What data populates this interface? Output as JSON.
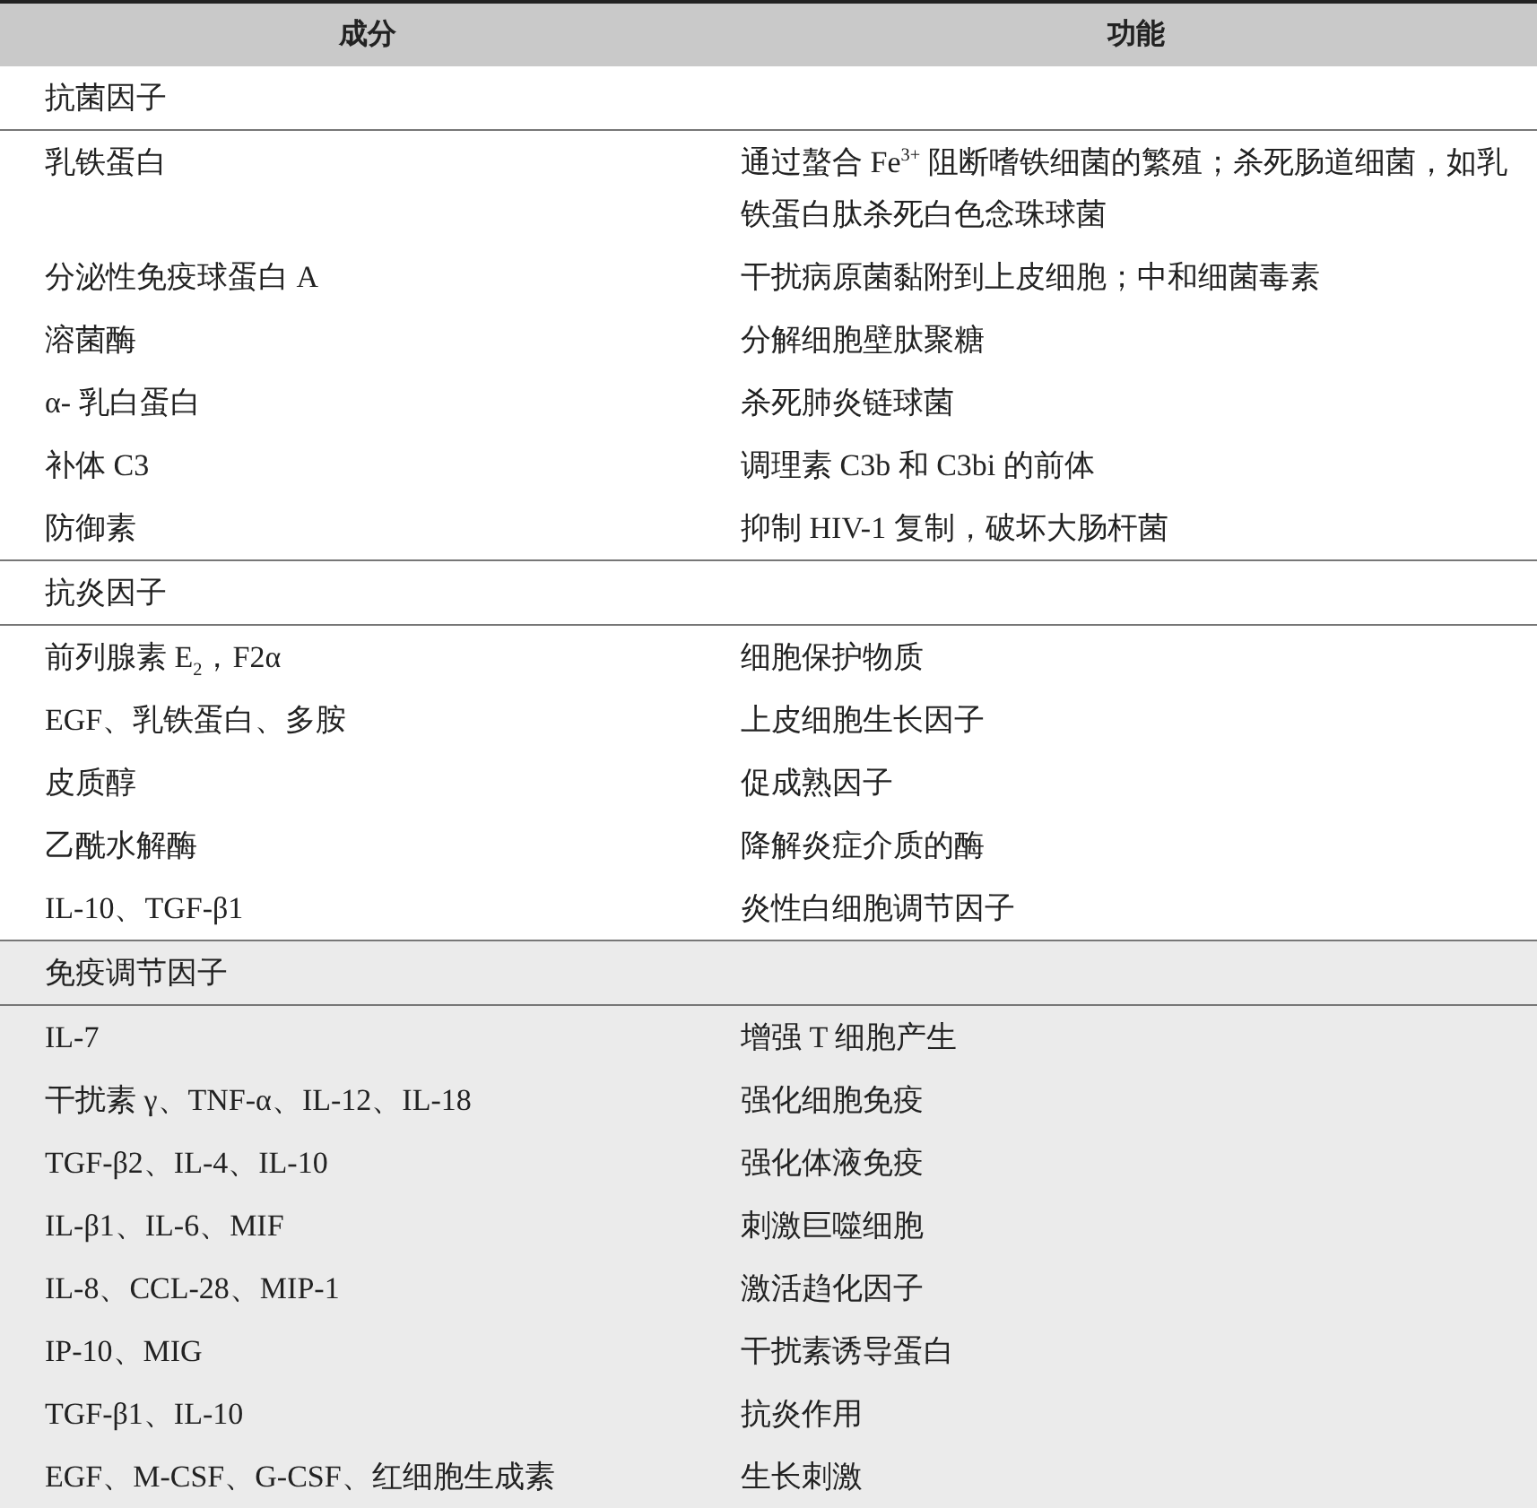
{
  "table": {
    "columns": [
      "成分",
      "功能"
    ],
    "groups": [
      {
        "title": "抗菌因子",
        "shaded": false,
        "rows": [
          {
            "component": "乳铁蛋白",
            "function": "通过螯合 Fe$^{3+}$ 阻断嗜铁细菌的繁殖；杀死肠道细菌，如乳铁蛋白肽杀死白色念珠球菌"
          },
          {
            "component": "分泌性免疫球蛋白 A",
            "function": "干扰病原菌黏附到上皮细胞；中和细菌毒素"
          },
          {
            "component": "溶菌酶",
            "function": "分解细胞壁肽聚糖"
          },
          {
            "component": "α- 乳白蛋白",
            "function": "杀死肺炎链球菌"
          },
          {
            "component": "补体 C3",
            "function": "调理素 C3b 和 C3bi 的前体"
          },
          {
            "component": "防御素",
            "function": "抑制 HIV-1 复制，破坏大肠杆菌"
          }
        ]
      },
      {
        "title": "抗炎因子",
        "shaded": false,
        "rows": [
          {
            "component": "前列腺素 E$_{2}$，F2α",
            "function": "细胞保护物质"
          },
          {
            "component": "EGF、乳铁蛋白、多胺",
            "function": "上皮细胞生长因子"
          },
          {
            "component": "皮质醇",
            "function": "促成熟因子"
          },
          {
            "component": "乙酰水解酶",
            "function": "降解炎症介质的酶"
          },
          {
            "component": "IL-10、TGF-β1",
            "function": "炎性白细胞调节因子"
          }
        ]
      },
      {
        "title": "免疫调节因子",
        "shaded": true,
        "rows": [
          {
            "component": "IL-7",
            "function": "增强 T 细胞产生"
          },
          {
            "component": "干扰素 γ、TNF-α、IL-12、IL-18",
            "function": "强化细胞免疫"
          },
          {
            "component": "TGF-β2、IL-4、IL-10",
            "function": "强化体液免疫"
          },
          {
            "component": "IL-β1、IL-6、MIF",
            "function": "刺激巨噬细胞"
          },
          {
            "component": "IL-8、CCL-28、MIP-1",
            "function": "激活趋化因子"
          },
          {
            "component": "IP-10、MIG",
            "function": "干扰素诱导蛋白"
          },
          {
            "component": "TGF-β1、IL-10",
            "function": "抗炎作用"
          },
          {
            "component": "EGF、M-CSF、G-CSF、红细胞生成素",
            "function": "生长刺激"
          }
        ]
      }
    ]
  }
}
